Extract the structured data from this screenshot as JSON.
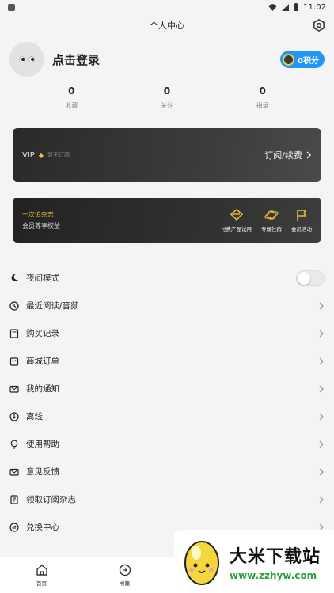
{
  "status_bar": {
    "time": "11:02"
  },
  "header": {
    "title": "个人中心"
  },
  "profile": {
    "login_text": "点击登录",
    "points_label": "0积分"
  },
  "stats": [
    {
      "value": "0",
      "label": "收藏"
    },
    {
      "value": "0",
      "label": "关注"
    },
    {
      "value": "0",
      "label": "捐录"
    }
  ],
  "vip_card": {
    "label": "VIP",
    "status": "暂无订阅",
    "action": "订阅/续费"
  },
  "benefits_card": {
    "title": "一次追杂志",
    "subtitle": "会员尊享权益",
    "items": [
      {
        "label": "付费产品试用"
      },
      {
        "label": "专属社群"
      },
      {
        "label": "会员活动"
      }
    ]
  },
  "menu": {
    "night_mode": "夜间模式",
    "recent": "最近阅读/音频",
    "purchases": "购买记录",
    "orders": "商城订单",
    "notifications": "我的通知",
    "offline": "离线",
    "help": "使用帮助",
    "feedback": "意见反馈",
    "subscriptions": "领取订阅杂志",
    "exchange": "兑换中心"
  },
  "night_mode_on": false,
  "bottom_nav": [
    {
      "label": "首页"
    },
    {
      "label": "书籍"
    }
  ],
  "watermark": {
    "title": "大米下载站",
    "url": "www.zzhyw.com"
  },
  "colors": {
    "accent": "#2196f3",
    "gold": "#e8b93a",
    "watermark_green": "#2e9e3d"
  }
}
